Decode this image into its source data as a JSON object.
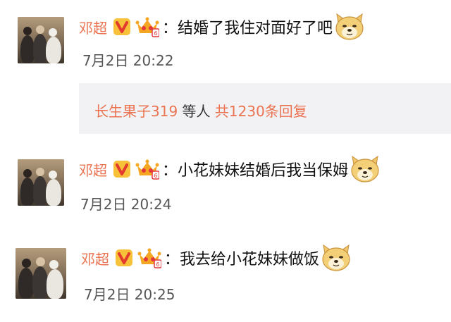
{
  "comments": [
    {
      "name": "邓超",
      "text": "：结婚了我住对面好了吧",
      "time": "7月2日 20:22"
    },
    {
      "name": "邓超",
      "text": "：小花妹妹结婚后我当保姆",
      "time": "7月2日 20:24"
    },
    {
      "name": "邓超",
      "text": "：我去给小花妹妹做饭",
      "time": "7月2日 20:25"
    }
  ],
  "reply_summary": {
    "user": "长生果子319",
    "middle": " 等人 ",
    "count": "共1230条回复"
  },
  "icons": {
    "verified": "verified-v-badge-icon",
    "vip": "vip-crown-icon",
    "emoji": "doge-emoji-icon"
  },
  "colors": {
    "name": "#eb7350",
    "reply_bg": "#f2f2f5",
    "verified": "#e8372f",
    "vip": "#f5a623"
  }
}
